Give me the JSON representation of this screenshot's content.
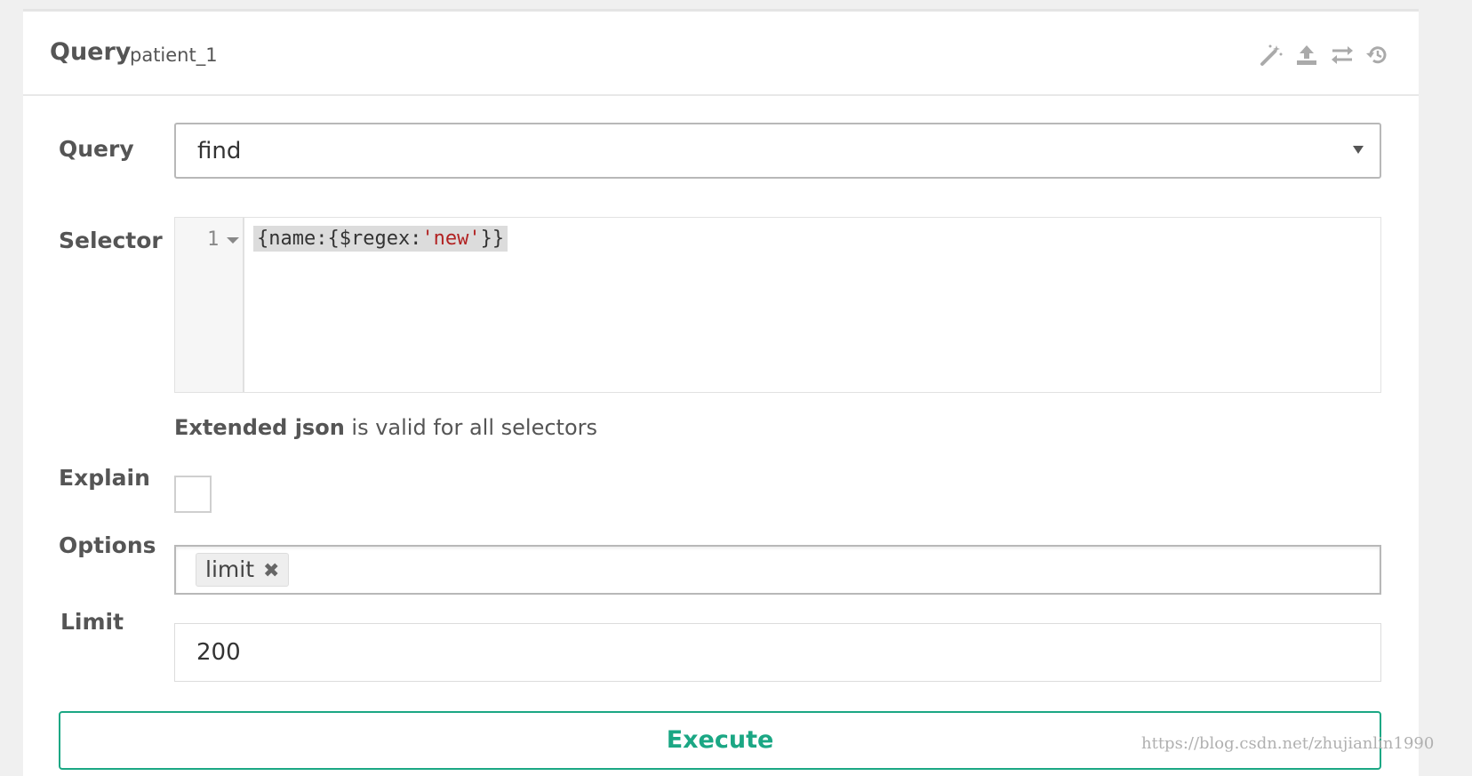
{
  "header": {
    "title": "Query",
    "collection": "patient_1",
    "icons": [
      "magic-wand-icon",
      "upload-icon",
      "swap-icon",
      "history-icon"
    ]
  },
  "form": {
    "query_label": "Query",
    "query_value": "find",
    "selector_label": "Selector",
    "selector_line_number": "1",
    "selector_code_prefix": "{name:{$regex:",
    "selector_code_string": "'new'",
    "selector_code_suffix": "}}",
    "help_bold": "Extended json",
    "help_rest": " is valid for all selectors",
    "explain_label": "Explain",
    "explain_checked": false,
    "options_label": "Options",
    "options_tags": [
      "limit"
    ],
    "limit_label": "Limit",
    "limit_value": "200",
    "execute_label": "Execute"
  },
  "watermark": "https://blog.csdn.net/zhujianlin1990",
  "colors": {
    "accent": "#1ba784",
    "string": "#b22222",
    "background": "#f0f0f0"
  }
}
